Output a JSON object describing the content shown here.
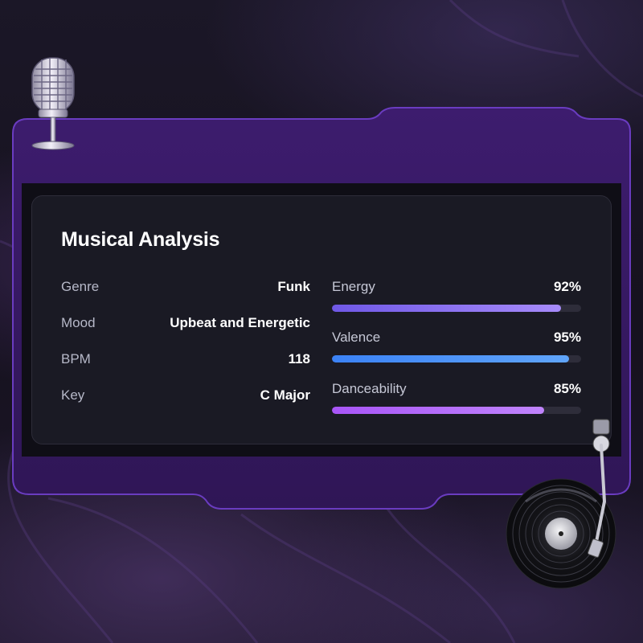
{
  "panel": {
    "title": "Musical Analysis",
    "rows": [
      {
        "label": "Genre",
        "value": "Funk"
      },
      {
        "label": "Mood",
        "value": "Upbeat and Energetic"
      },
      {
        "label": "BPM",
        "value": "118"
      },
      {
        "label": "Key",
        "value": "C Major"
      }
    ],
    "metrics": [
      {
        "label": "Energy",
        "value_text": "92%",
        "level": 0.92,
        "gradient": [
          "#6f58e6",
          "#a78bfa"
        ]
      },
      {
        "label": "Valence",
        "value_text": "95%",
        "level": 0.95,
        "gradient": [
          "#3b82f6",
          "#60a5fa"
        ]
      },
      {
        "label": "Danceability",
        "value_text": "85%",
        "level": 0.85,
        "gradient": [
          "#a855f7",
          "#c084fc"
        ]
      }
    ]
  },
  "decorations": {
    "top_left": "microphone-icon",
    "bottom_right": "turntable-record-icon"
  },
  "colors": {
    "frame_purple": "#3c1d6b",
    "frame_border": "#6a3cc0",
    "card_bg": "#1a1a24",
    "text_primary": "#ffffff",
    "text_secondary": "#b6b8c8"
  }
}
